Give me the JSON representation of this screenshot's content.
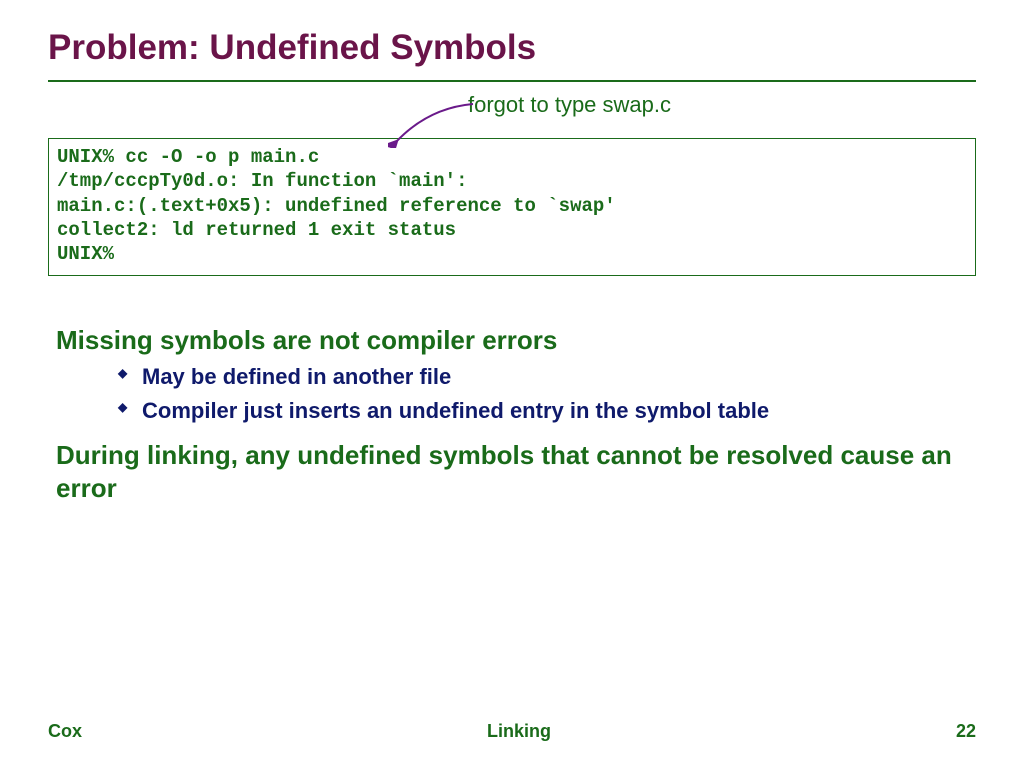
{
  "title": "Problem: Undefined Symbols",
  "annotation": "forgot to type swap.c",
  "code": {
    "l1": "UNIX% cc -O -o p main.c",
    "l2": "/tmp/cccpTy0d.o: In function `main':",
    "l3": "main.c:(.text+0x5): undefined reference to `swap'",
    "l4": "collect2: ld returned 1 exit status",
    "l5": "UNIX%"
  },
  "para1": "Missing symbols are not compiler errors",
  "bullets": {
    "b1": "May be defined in another file",
    "b2": "Compiler just inserts an undefined entry in the symbol table"
  },
  "para2": "During linking, any undefined symbols that cannot be resolved cause an error",
  "footer": {
    "left": "Cox",
    "center": "Linking",
    "right": "22"
  },
  "colors": {
    "title": "#6a1449",
    "green": "#1a6b1a",
    "navy": "#0f1a6b",
    "arrow": "#6a1a8a"
  }
}
